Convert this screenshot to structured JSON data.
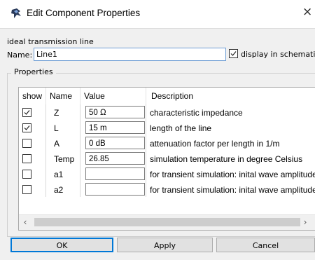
{
  "window": {
    "title": "Edit Component Properties",
    "close_symbol": "×"
  },
  "component": {
    "description": "ideal transmission line",
    "name_label": "Name:",
    "name_value": "Line1",
    "display_label": "display in schematic",
    "display_checked": true
  },
  "properties": {
    "group_label": "Properties",
    "columns": [
      "show",
      "Name",
      "Value",
      "Description"
    ],
    "rows": [
      {
        "show": true,
        "name": "Z",
        "value": "50 Ω",
        "description": "characteristic impedance"
      },
      {
        "show": true,
        "name": "L",
        "value": "15 m",
        "description": "length of the line"
      },
      {
        "show": false,
        "name": "A",
        "value": "0 dB",
        "description": "attenuation factor per length in 1/m"
      },
      {
        "show": false,
        "name": "Temp",
        "value": "26.85",
        "description": "simulation temperature in degree Celsius"
      },
      {
        "show": false,
        "name": "a1",
        "value": "",
        "description": "for transient simulation: inital wave amplitude"
      },
      {
        "show": false,
        "name": "a2",
        "value": "",
        "description": "for transient simulation: inital wave amplitude"
      }
    ]
  },
  "buttons": {
    "ok": "OK",
    "apply": "Apply",
    "cancel": "Cancel"
  },
  "icons": {
    "app": "qucs-app-icon",
    "check": "check-icon",
    "left": "scroll-left-icon",
    "right": "scroll-right-icon"
  },
  "colors": {
    "accent": "#0078d7",
    "focus_border": "#6f9ed5",
    "dialog_bg": "#f0f0f0"
  }
}
